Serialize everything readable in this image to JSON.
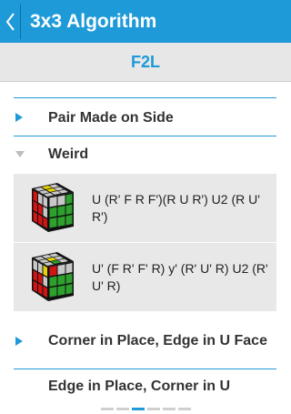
{
  "appbar": {
    "title": "3x3 Algorithm"
  },
  "section": {
    "title": "F2L"
  },
  "list": [
    {
      "label": "Pair Made on Side",
      "expanded": false
    },
    {
      "label": "Weird",
      "expanded": true
    },
    {
      "label": "Corner in Place, Edge in U Face",
      "expanded": false
    },
    {
      "label": "Edge in Place, Corner in U",
      "expanded": false
    }
  ],
  "algorithms": [
    {
      "text": "U (R' F R F')(R U R') U2 (R U' R')"
    },
    {
      "text": "U' (F R' F' R) y' (R' U' R) U2 (R' U' R)"
    }
  ],
  "pager": {
    "count": 6,
    "active_index": 2
  },
  "colors": {
    "accent": "#1e9ad8"
  }
}
